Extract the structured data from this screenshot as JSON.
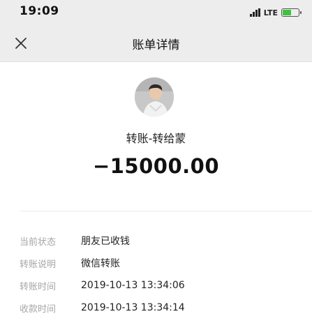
{
  "status_bar": {
    "time": "19:09",
    "network": "LTE",
    "battery_level": 0.6,
    "battery_color": "#3cc23c"
  },
  "nav": {
    "title": "账单详情",
    "close_icon": "close-icon"
  },
  "transfer": {
    "avatar_icon": "user-avatar",
    "title": "转账-转给蒙",
    "amount": "−15000.00"
  },
  "details": [
    {
      "label": "当前状态",
      "value": "朋友已收钱"
    },
    {
      "label": "转账说明",
      "value": "微信转账"
    },
    {
      "label": "转账时间",
      "value": "2019-10-13 13:34:06"
    },
    {
      "label": "收款时间",
      "value": "2019-10-13 13:34:14"
    }
  ]
}
